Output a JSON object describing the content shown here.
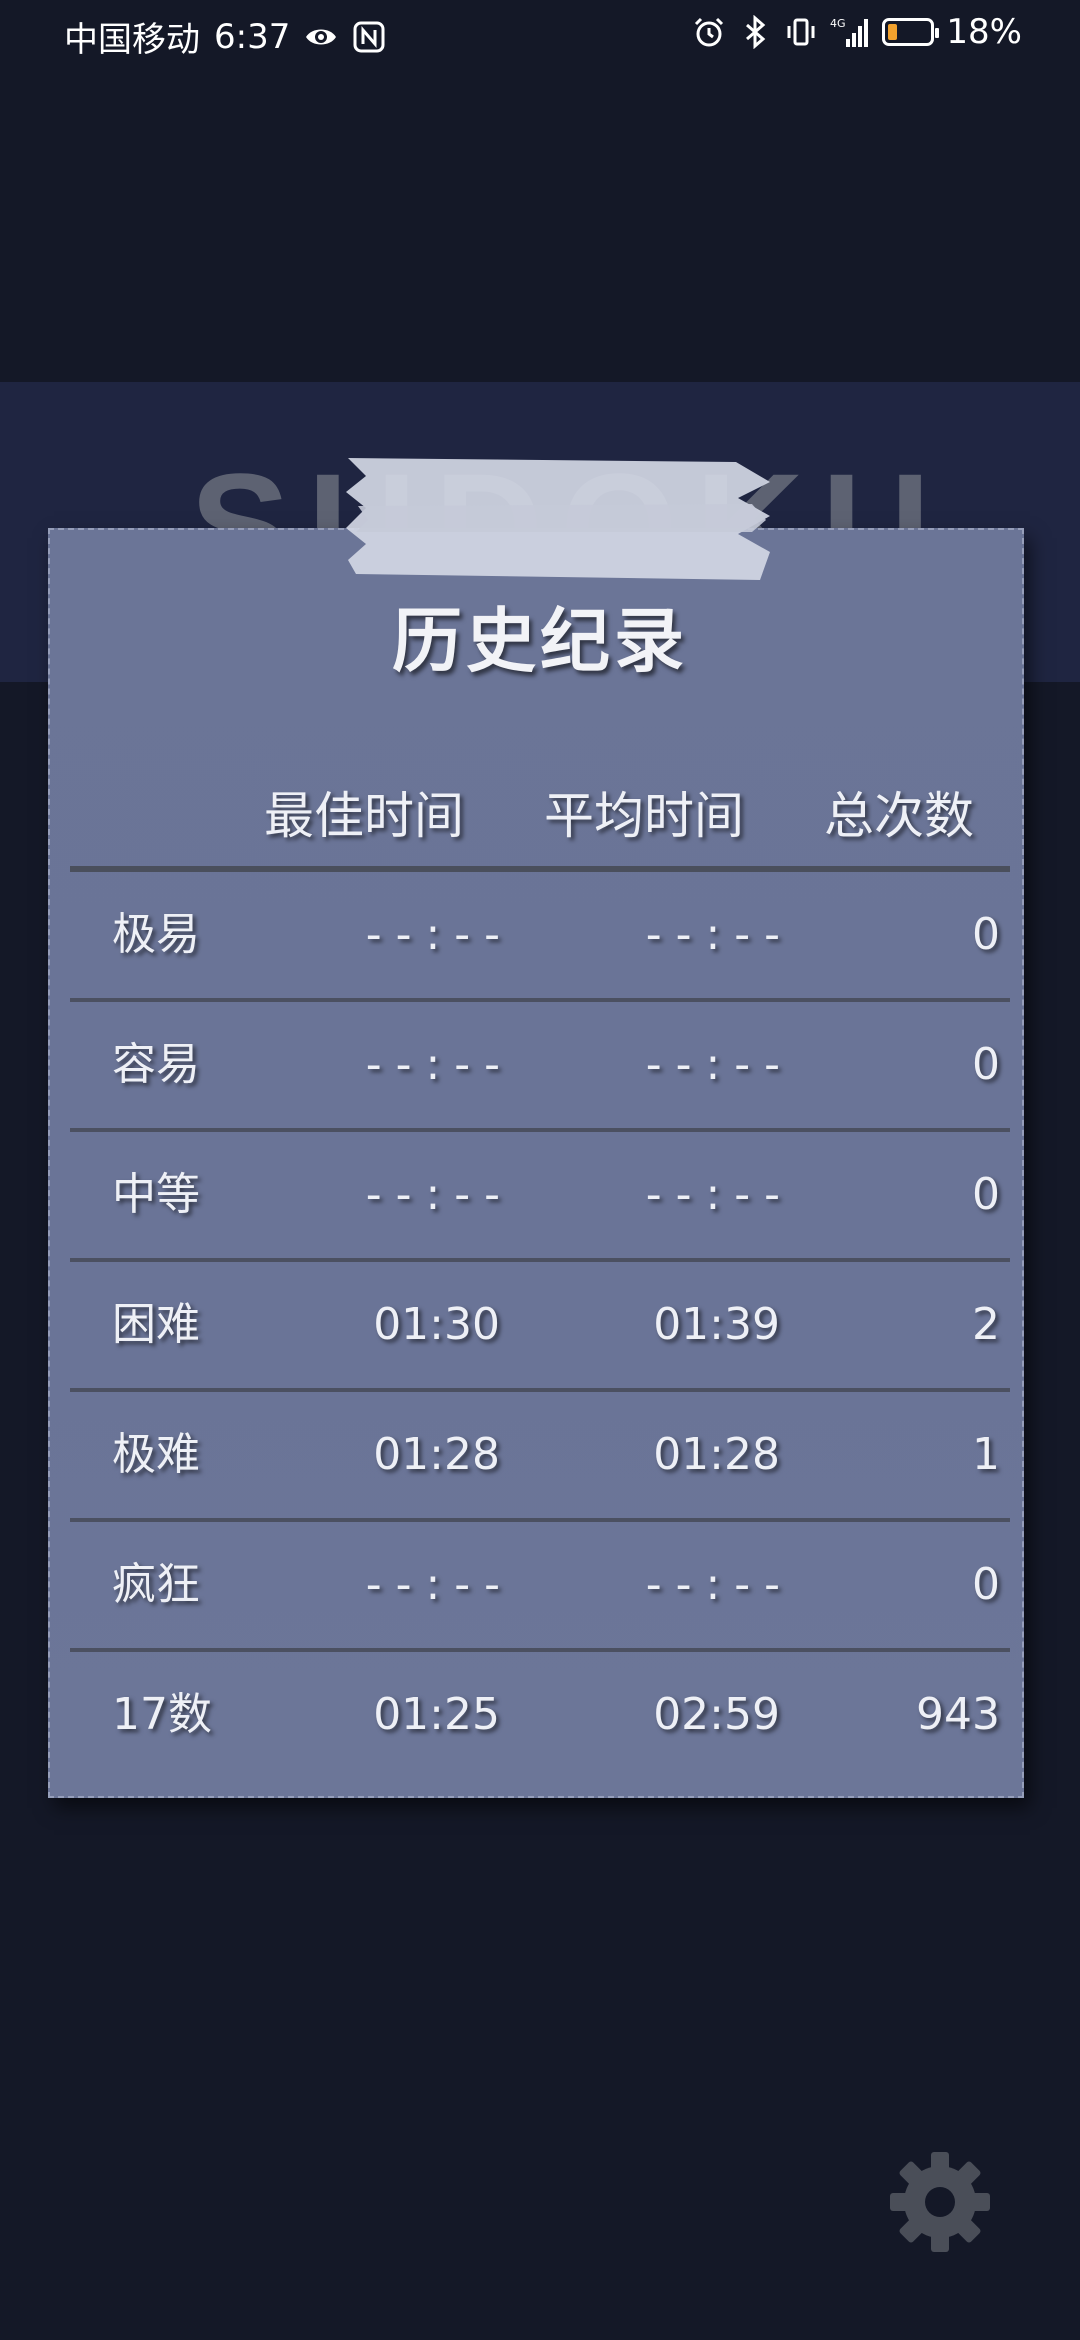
{
  "status_bar": {
    "carrier": "中国移动",
    "time": "6:37",
    "battery_percent": "18%",
    "battery_level": 0.18,
    "icons": [
      "eye-icon",
      "nfc-icon",
      "alarm-icon",
      "bluetooth-icon",
      "vibrate-icon",
      "signal-4g-icon",
      "battery-icon"
    ]
  },
  "app": {
    "logo_text": "SUDOKU"
  },
  "records": {
    "title": "历史纪录",
    "headers": {
      "best": "最佳时间",
      "average": "平均时间",
      "total": "总次数"
    },
    "rows": [
      {
        "level": "极易",
        "best": "- - : - -",
        "average": "- - : - -",
        "count": "0"
      },
      {
        "level": "容易",
        "best": "- - : - -",
        "average": "- - : - -",
        "count": "0"
      },
      {
        "level": "中等",
        "best": "- - : - -",
        "average": "- - : - -",
        "count": "0"
      },
      {
        "level": "困难",
        "best": "01:30",
        "average": "01:39",
        "count": "2"
      },
      {
        "level": "极难",
        "best": "01:28",
        "average": "01:28",
        "count": "1"
      },
      {
        "level": "疯狂",
        "best": "- - : - -",
        "average": "- - : - -",
        "count": "0"
      },
      {
        "level": "17数",
        "best": "01:25",
        "average": "02:59",
        "count": "943"
      }
    ]
  },
  "colors": {
    "background": "#141827",
    "header_band": "#1f2541",
    "card": "#6b7597",
    "divider": "#4b5061",
    "battery_low": "#f2a12d"
  }
}
